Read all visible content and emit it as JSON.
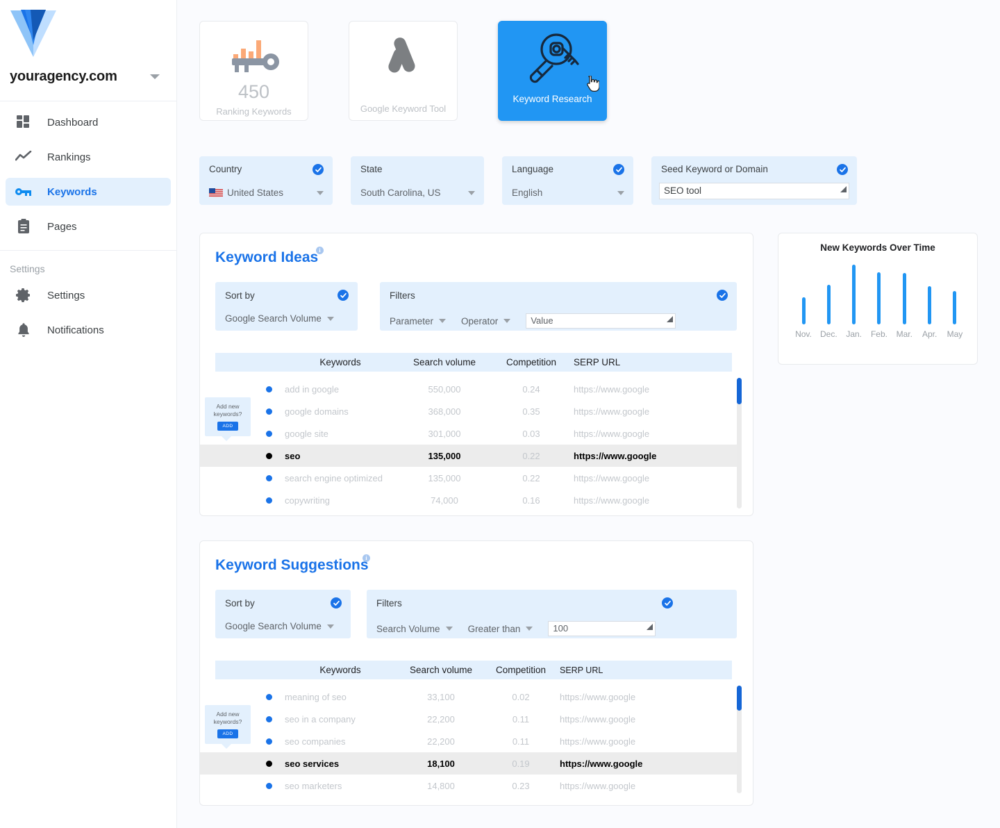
{
  "sidebar": {
    "brand": "youragency.com",
    "group_label": "Settings",
    "items": [
      {
        "label": "Dashboard",
        "icon": "dashboard-icon",
        "active": false
      },
      {
        "label": "Rankings",
        "icon": "chart-line-icon",
        "active": false
      },
      {
        "label": "Keywords",
        "icon": "key-icon",
        "active": true
      },
      {
        "label": "Pages",
        "icon": "clipboard-icon",
        "active": false
      }
    ],
    "settings_items": [
      {
        "label": "Settings",
        "icon": "gear-icon"
      },
      {
        "label": "Notifications",
        "icon": "bell-icon"
      }
    ]
  },
  "tool_cards": [
    {
      "id": "ranking-keywords",
      "value": "450",
      "label": "Ranking Keywords",
      "icon": "key-bars-icon",
      "active": false
    },
    {
      "id": "google-keyword-tool",
      "value": "",
      "label": "Google Keyword Tool",
      "icon": "google-ads-icon",
      "active": false
    },
    {
      "id": "keyword-research",
      "value": "",
      "label": "Keyword Research",
      "icon": "magnifier-key-icon",
      "active": true
    }
  ],
  "selectors": [
    {
      "id": "country",
      "title": "Country",
      "value": "United States",
      "checked": true,
      "has_flag": true,
      "type": "dropdown"
    },
    {
      "id": "state",
      "title": "State",
      "value": "South Carolina, US",
      "checked": false,
      "has_flag": false,
      "type": "dropdown"
    },
    {
      "id": "language",
      "title": "Language",
      "value": "English",
      "checked": true,
      "has_flag": false,
      "type": "dropdown"
    },
    {
      "id": "seed",
      "title": "Seed Keyword or Domain",
      "value": "SEO tool",
      "checked": true,
      "has_flag": false,
      "type": "input"
    }
  ],
  "keyword_ideas": {
    "title": "Keyword Ideas",
    "info_char": "i",
    "sort_by": {
      "title": "Sort by",
      "value": "Google Search Volume",
      "checked": true
    },
    "filters": {
      "title": "Filters",
      "checked": true,
      "parameter": "Parameter",
      "operator": "Operator",
      "value_placeholder": "Value",
      "value": ""
    },
    "columns": [
      "",
      "Keywords",
      "Search volume",
      "Competition",
      "SERP URL"
    ],
    "rows": [
      {
        "keyword": "add in google",
        "volume": "550,000",
        "competition": "0.24",
        "url": "https://www.google",
        "selected": false
      },
      {
        "keyword": "google domains",
        "volume": "368,000",
        "competition": "0.35",
        "url": "https://www.google",
        "selected": false
      },
      {
        "keyword": "google site",
        "volume": "301,000",
        "competition": "0.03",
        "url": "https://www.google",
        "selected": false
      },
      {
        "keyword": "seo",
        "volume": "135,000",
        "competition": "0.22",
        "url": "https://www.google",
        "selected": true
      },
      {
        "keyword": "search engine optimized",
        "volume": "135,000",
        "competition": "0.22",
        "url": "https://www.google",
        "selected": false
      },
      {
        "keyword": "copywriting",
        "volume": "74,000",
        "competition": "0.16",
        "url": "https://www.google",
        "selected": false
      }
    ],
    "add_bubble": {
      "line1": "Add new",
      "line2": "keywords?",
      "button": "ADD"
    }
  },
  "keyword_suggestions": {
    "title": "Keyword Suggestions",
    "info_char": "i",
    "sort_by": {
      "title": "Sort by",
      "value": "Google Search Volume",
      "checked": true
    },
    "filters": {
      "title": "Filters",
      "checked": true,
      "parameter": "Search Volume",
      "operator": "Greater than",
      "value_placeholder": "",
      "value": "100"
    },
    "columns": [
      "",
      "Keywords",
      "Search volume",
      "Competition",
      "SERP URL"
    ],
    "rows": [
      {
        "keyword": "meaning of seo",
        "volume": "33,100",
        "competition": "0.02",
        "url": "https://www.google",
        "selected": false
      },
      {
        "keyword": "seo in a company",
        "volume": "22,200",
        "competition": "0.11",
        "url": "https://www.google",
        "selected": false
      },
      {
        "keyword": "seo companies",
        "volume": "22,200",
        "competition": "0.11",
        "url": "https://www.google",
        "selected": false
      },
      {
        "keyword": "seo services",
        "volume": "18,100",
        "competition": "0.19",
        "url": "https://www.google",
        "selected": true
      },
      {
        "keyword": "seo marketers",
        "volume": "14,800",
        "competition": "0.23",
        "url": "https://www.google",
        "selected": false
      }
    ],
    "add_bubble": {
      "line1": "Add new",
      "line2": "keywords?",
      "button": "ADD"
    }
  },
  "chart_data": {
    "type": "bar",
    "title": "New Keywords Over Time",
    "categories": [
      "Nov.",
      "Dec.",
      "Jan.",
      "Feb.",
      "Mar.",
      "Apr.",
      "May"
    ],
    "values": [
      45,
      67,
      100,
      88,
      86,
      64,
      56
    ],
    "xlabel": "",
    "ylabel": "",
    "ylim": [
      0,
      105
    ],
    "grid": false,
    "legend": "none",
    "bar_color": "#2196f3"
  },
  "colors": {
    "accent": "#1a73e8",
    "active_card": "#2196f3",
    "panel_bg": "#e3f0fd",
    "page_bg": "#fafbfe",
    "muted_text": "#c3c7cc"
  }
}
